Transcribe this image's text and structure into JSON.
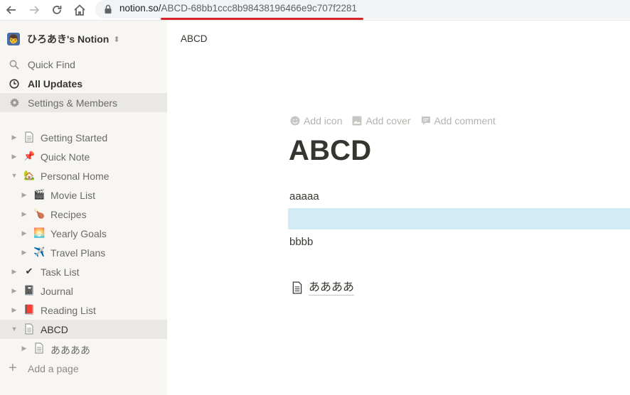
{
  "browser": {
    "url_host": "notion.so/",
    "url_path": "ABCD-68bb1ccc8b98438196466e9c707f2281"
  },
  "sidebar": {
    "workspace_name": "ひろあき's Notion",
    "workspace_avatar": "👦",
    "menu": [
      {
        "label": "Quick Find",
        "icon": "search-icon"
      },
      {
        "label": "All Updates",
        "icon": "clock-icon"
      },
      {
        "label": "Settings & Members",
        "icon": "gear-icon"
      }
    ],
    "pages": [
      {
        "label": "Getting Started",
        "emoji": "📄",
        "level": 0
      },
      {
        "label": "Quick Note",
        "emoji": "📌",
        "level": 0
      },
      {
        "label": "Personal Home",
        "emoji": "🏡",
        "level": 0
      },
      {
        "label": "Movie List",
        "emoji": "🎬",
        "level": 1
      },
      {
        "label": "Recipes",
        "emoji": "🍗",
        "level": 1
      },
      {
        "label": "Yearly Goals",
        "emoji": "🌅",
        "level": 1
      },
      {
        "label": "Travel Plans",
        "emoji": "✈️",
        "level": 1
      },
      {
        "label": "Task List",
        "emoji": "✔",
        "level": 0
      },
      {
        "label": "Journal",
        "emoji": "📓",
        "level": 0
      },
      {
        "label": "Reading List",
        "emoji": "📕",
        "level": 0
      },
      {
        "label": "ABCD",
        "emoji": "📄",
        "level": 0
      },
      {
        "label": "ああああ",
        "emoji": "📄",
        "level": 1
      }
    ],
    "add_page": "Add a page"
  },
  "main": {
    "breadcrumb": "ABCD",
    "actions": {
      "add_icon": "Add icon",
      "add_cover": "Add cover",
      "add_comment": "Add comment"
    },
    "title": "ABCD",
    "blocks": {
      "first": "aaaaa",
      "second": "bbbb"
    },
    "subpage": "ああああ"
  },
  "colors": {
    "sidebar_bg": "#f7f6f3",
    "selection": "#d3ebf6",
    "url_underline": "#d8232a"
  }
}
